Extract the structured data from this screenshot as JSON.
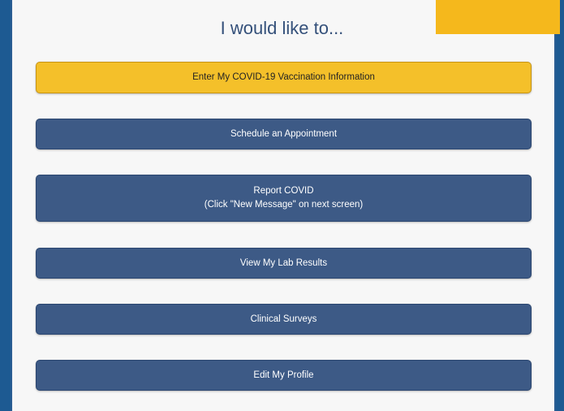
{
  "heading": "I would like to...",
  "buttons": {
    "vaccination": "Enter My COVID-19 Vaccination Information",
    "appointment": "Schedule an Appointment",
    "report_line1": "Report COVID",
    "report_line2": "(Click \"New Message\" on next screen)",
    "lab_results": "View My Lab Results",
    "surveys": "Clinical Surveys",
    "profile": "Edit My Profile"
  },
  "colors": {
    "primary_button": "#3d5a86",
    "highlight_button": "#f4c02a",
    "accent": "#f5b81c",
    "background": "#1d5a92"
  }
}
